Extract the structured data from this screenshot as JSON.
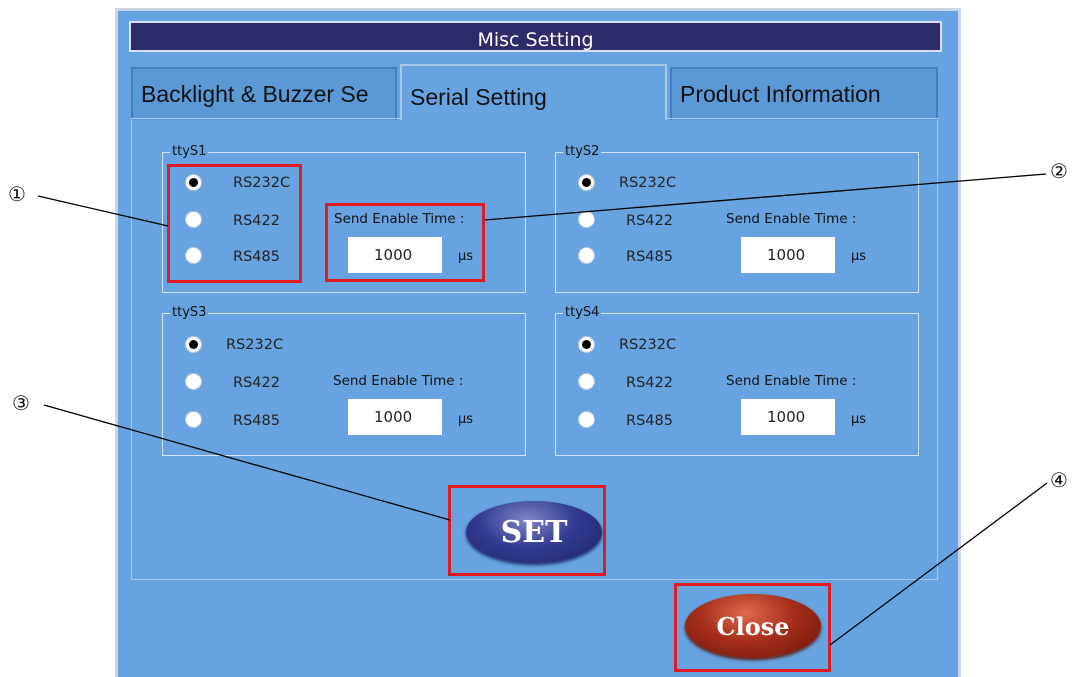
{
  "window": {
    "title": "Misc Setting"
  },
  "tabs": [
    {
      "label": "Backlight & Buzzer Se",
      "active": false
    },
    {
      "label": "Serial Setting",
      "active": true
    },
    {
      "label": "Product Information",
      "active": false
    }
  ],
  "ports": [
    {
      "name": "ttyS1",
      "options": [
        "RS232C",
        "RS422",
        "RS485"
      ],
      "selected": "RS232C",
      "send_label": "Send Enable Time :",
      "value": "1000",
      "unit": "μs"
    },
    {
      "name": "ttyS2",
      "options": [
        "RS232C",
        "RS422",
        "RS485"
      ],
      "selected": "RS232C",
      "send_label": "Send Enable Time :",
      "value": "1000",
      "unit": "μs"
    },
    {
      "name": "ttyS3",
      "options": [
        "RS232C",
        "RS422",
        "RS485"
      ],
      "selected": "RS232C",
      "send_label": "Send Enable Time :",
      "value": "1000",
      "unit": "μs"
    },
    {
      "name": "ttyS4",
      "options": [
        "RS232C",
        "RS422",
        "RS485"
      ],
      "selected": "RS232C",
      "send_label": "Send Enable Time :",
      "value": "1000",
      "unit": "μs"
    }
  ],
  "buttons": {
    "set": "SET",
    "close": "Close"
  },
  "callouts": [
    "①",
    "②",
    "③",
    "④"
  ],
  "colors": {
    "window_bg": "#66a3e0",
    "title_bg": "#2e2b6b",
    "highlight": "#e11a22",
    "set_button": "#343c93",
    "close_button": "#a52e1b"
  }
}
